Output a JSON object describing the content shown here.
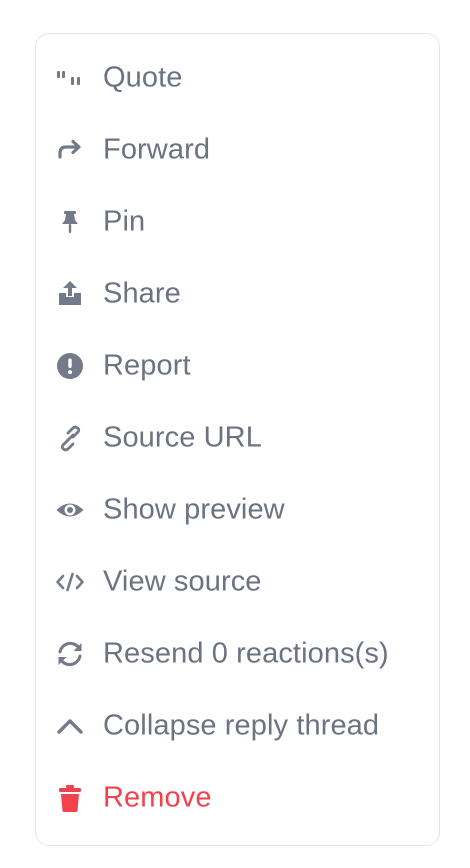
{
  "menu": {
    "items": [
      {
        "label": "Quote",
        "icon": "quote-icon"
      },
      {
        "label": "Forward",
        "icon": "forward-icon"
      },
      {
        "label": "Pin",
        "icon": "pin-icon"
      },
      {
        "label": "Share",
        "icon": "share-icon"
      },
      {
        "label": "Report",
        "icon": "exclamation-circle-icon"
      },
      {
        "label": "Source URL",
        "icon": "link-icon"
      },
      {
        "label": "Show preview",
        "icon": "eye-icon"
      },
      {
        "label": "View source",
        "icon": "code-icon"
      },
      {
        "label": "Resend 0 reactions(s)",
        "icon": "refresh-icon"
      },
      {
        "label": "Collapse reply thread",
        "icon": "chevron-up-icon"
      },
      {
        "label": "Remove",
        "icon": "trash-icon"
      }
    ]
  },
  "colors": {
    "text": "#6b7282",
    "icon": "#737a8a",
    "danger": "#f2424c",
    "border": "#e2e4e8"
  }
}
